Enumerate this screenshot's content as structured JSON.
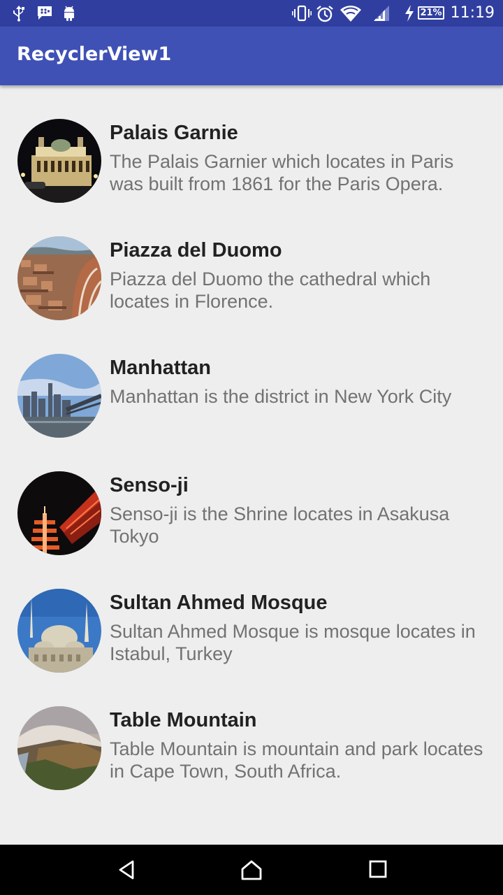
{
  "status_bar": {
    "time": "11:19",
    "battery": "21%",
    "left_icons": [
      "usb-icon",
      "bbm-icon",
      "android-icon"
    ],
    "right_icons": [
      "vibrate-icon",
      "alarm-icon",
      "wifi-icon",
      "signal-icon",
      "charging-icon",
      "battery-icon"
    ]
  },
  "app_bar": {
    "title": "RecyclerView1"
  },
  "items": [
    {
      "title": "Palais Garnie",
      "description": "The Palais Garnier which locates in Paris was built from 1861 for the Paris Opera."
    },
    {
      "title": "Piazza del Duomo",
      "description": "Piazza del Duomo the cathedral which locates in Florence."
    },
    {
      "title": "Manhattan",
      "description": "Manhattan is the district in New York City"
    },
    {
      "title": "Senso-ji",
      "description": "Senso-ji is the Shrine locates in Asakusa Tokyo"
    },
    {
      "title": "Sultan Ahmed Mosque",
      "description": "Sultan Ahmed Mosque is mosque locates in Istabul, Turkey"
    },
    {
      "title": "Table Mountain",
      "description": "Table Mountain is mountain and park locates in Cape Town, South Africa."
    }
  ],
  "nav_bar": {
    "buttons": [
      "back-icon",
      "home-icon",
      "recents-icon"
    ]
  },
  "colors": {
    "status_bar": "#303f9f",
    "app_bar": "#3f51b5",
    "background": "#eeeeee"
  }
}
